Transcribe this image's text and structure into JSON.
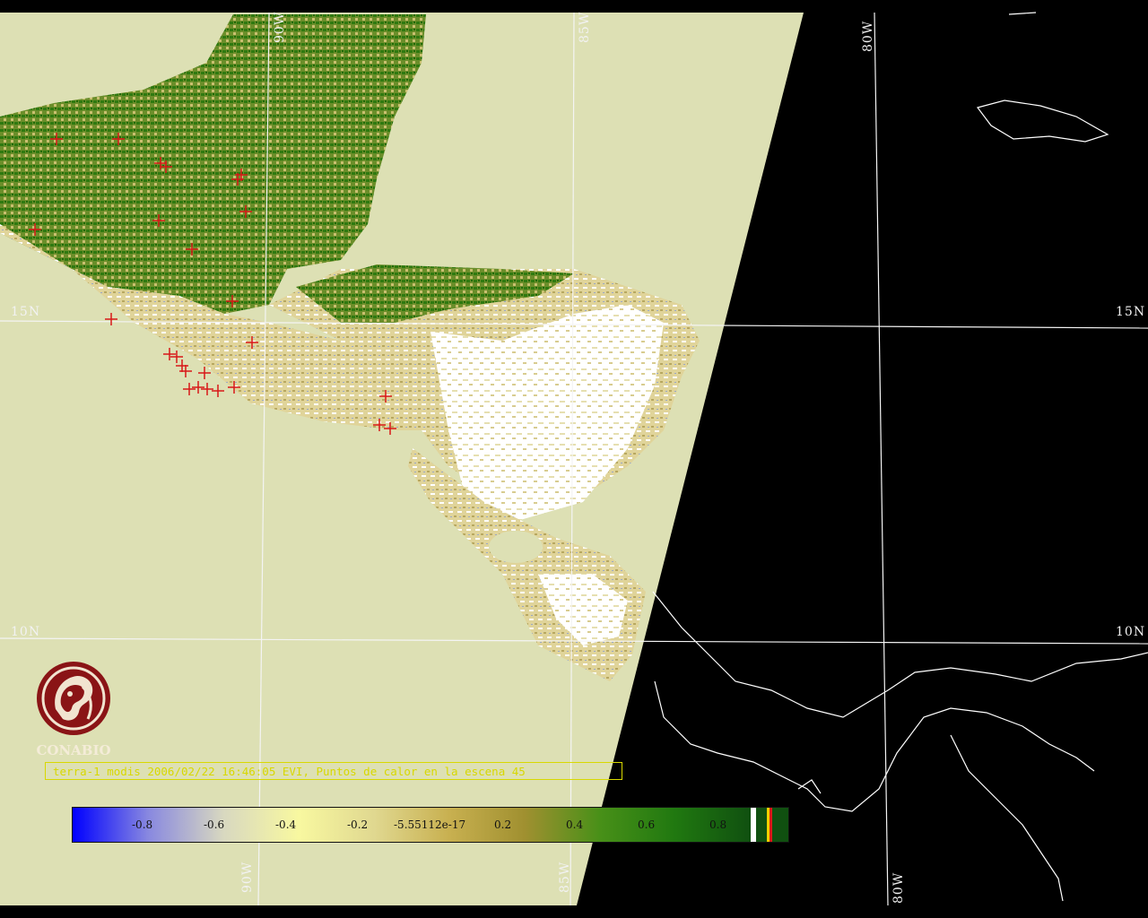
{
  "map": {
    "grid_labels": {
      "lat_15_left": "15N",
      "lat_10_left": "10N",
      "lat_15_right": "15N",
      "lat_10_right": "10N",
      "lon_90_top": "90W",
      "lon_85_top": "85W",
      "lon_80_top": "80W",
      "lon_90_bottom": "90W",
      "lon_85_bottom": "85W",
      "lon_80_bottom": "80W"
    },
    "colors": {
      "background_land_scan": "#dde0b4",
      "no_data": "#000000",
      "coastline": "#ffffff",
      "grid": "#f4f4f4",
      "hotspot": "#d81818",
      "caption": "#d8d800"
    },
    "hotspot_marker": "+",
    "hotspot_count_shown": "45"
  },
  "logo": {
    "text": "CONABIO",
    "icon": "conabio-logo-icon"
  },
  "caption": {
    "text": "terra-1 modis 2006/02/22 16:46:05 EVI, Puntos de calor en la escena 45"
  },
  "colorbar": {
    "ticks": [
      "-0.8",
      "-0.6",
      "-0.4",
      "-0.2",
      "-5.55112e-17",
      "0.2",
      "0.4",
      "0.6",
      "0.8"
    ],
    "gradient_colors": [
      "#0000ff",
      "#8888e0",
      "#d8d8c0",
      "#f8f8a0",
      "#e0d890",
      "#c8b050",
      "#a09030",
      "#489018",
      "#207810",
      "#105010"
    ]
  }
}
